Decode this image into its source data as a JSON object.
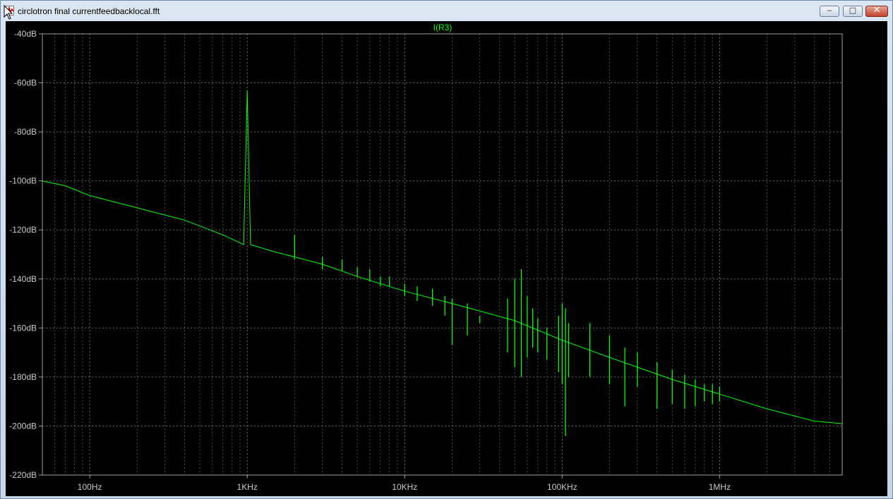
{
  "window": {
    "title": "circlotron final currentfeedbacklocal.fft",
    "buttons": {
      "minimize": "‒",
      "maximize": "□",
      "close": "✕"
    }
  },
  "colors": {
    "trace": "#00ff00",
    "grid": "#808080",
    "axis_text": "#c8c8c8",
    "plot_bg": "#000000"
  },
  "chart_data": {
    "type": "line",
    "title": "I(R3)",
    "x_scale": "log",
    "xlim": [
      50,
      6000000
    ],
    "ylim": [
      -220,
      -40
    ],
    "x_tick_labels": [
      {
        "value": 100,
        "label": "100Hz"
      },
      {
        "value": 1000,
        "label": "1KHz"
      },
      {
        "value": 10000,
        "label": "10KHz"
      },
      {
        "value": 100000,
        "label": "100KHz"
      },
      {
        "value": 1000000,
        "label": "1MHz"
      }
    ],
    "y_ticks": [
      -40,
      -60,
      -80,
      -100,
      -120,
      -140,
      -160,
      -180,
      -200,
      -220
    ],
    "y_tick_labels": [
      "-40dB",
      "-60dB",
      "-80dB",
      "-100dB",
      "-120dB",
      "-140dB",
      "-160dB",
      "-180dB",
      "-200dB",
      "-220dB"
    ],
    "series": [
      {
        "name": "I(R3)",
        "x": [
          50,
          70,
          100,
          200,
          400,
          700,
          950,
          1000,
          1050,
          1500,
          2000,
          3000,
          5000,
          10000,
          20000,
          50000,
          100000,
          200000,
          500000,
          1000000,
          2000000,
          4000000,
          6000000
        ],
        "y": [
          -100,
          -102,
          -106,
          -111,
          -116,
          -122,
          -126,
          -63,
          -126,
          -129,
          -131,
          -134,
          -139,
          -145,
          -150,
          -157,
          -165,
          -172,
          -181,
          -187,
          -193,
          -198,
          -199
        ]
      }
    ],
    "spikes": [
      {
        "x": 2000,
        "top": -122,
        "bottom": -132
      },
      {
        "x": 3000,
        "top": -131,
        "bottom": -136
      },
      {
        "x": 4000,
        "top": -132,
        "bottom": -137
      },
      {
        "x": 5000,
        "top": -135,
        "bottom": -139
      },
      {
        "x": 6000,
        "top": -136,
        "bottom": -141
      },
      {
        "x": 7000,
        "top": -139,
        "bottom": -143
      },
      {
        "x": 8000,
        "top": -139,
        "bottom": -143
      },
      {
        "x": 10000,
        "top": -142,
        "bottom": -147
      },
      {
        "x": 12000,
        "top": -143,
        "bottom": -149
      },
      {
        "x": 15000,
        "top": -144,
        "bottom": -151
      },
      {
        "x": 18000,
        "top": -147,
        "bottom": -155
      },
      {
        "x": 20000,
        "top": -148,
        "bottom": -167
      },
      {
        "x": 25000,
        "top": -150,
        "bottom": -163
      },
      {
        "x": 30000,
        "top": -155,
        "bottom": -158
      },
      {
        "x": 45000,
        "top": -148,
        "bottom": -170
      },
      {
        "x": 50000,
        "top": -140,
        "bottom": -176
      },
      {
        "x": 55000,
        "top": -136,
        "bottom": -180
      },
      {
        "x": 60000,
        "top": -147,
        "bottom": -172
      },
      {
        "x": 65000,
        "top": -152,
        "bottom": -168
      },
      {
        "x": 70000,
        "top": -156,
        "bottom": -170
      },
      {
        "x": 80000,
        "top": -160,
        "bottom": -173
      },
      {
        "x": 95000,
        "top": -155,
        "bottom": -178
      },
      {
        "x": 100000,
        "top": -150,
        "bottom": -183
      },
      {
        "x": 105000,
        "top": -152,
        "bottom": -204
      },
      {
        "x": 110000,
        "top": -158,
        "bottom": -180
      },
      {
        "x": 150000,
        "top": -158,
        "bottom": -180
      },
      {
        "x": 200000,
        "top": -163,
        "bottom": -183
      },
      {
        "x": 250000,
        "top": -168,
        "bottom": -192
      },
      {
        "x": 300000,
        "top": -170,
        "bottom": -184
      },
      {
        "x": 400000,
        "top": -174,
        "bottom": -193
      },
      {
        "x": 500000,
        "top": -177,
        "bottom": -191
      },
      {
        "x": 600000,
        "top": -179,
        "bottom": -193
      },
      {
        "x": 700000,
        "top": -181,
        "bottom": -192
      },
      {
        "x": 800000,
        "top": -183,
        "bottom": -190
      },
      {
        "x": 900000,
        "top": -183,
        "bottom": -191
      },
      {
        "x": 1000000,
        "top": -184,
        "bottom": -190
      }
    ],
    "grid": true,
    "legend": "top-center"
  }
}
